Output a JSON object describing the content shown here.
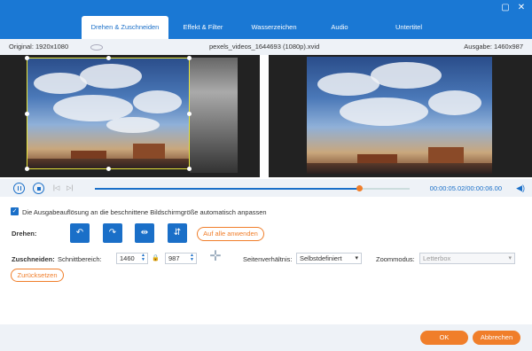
{
  "tabs": [
    {
      "label": "Drehen & Zuschneiden"
    },
    {
      "label": "Effekt & Filter"
    },
    {
      "label": "Wasserzeichen"
    },
    {
      "label": "Audio"
    },
    {
      "label": "Untertitel"
    }
  ],
  "window": {
    "minimize_icon": "minimize-icon",
    "close_icon": "close-icon"
  },
  "info": {
    "original": "Original: 1920x1080",
    "filename": "pexels_videos_1644693 (1080p).xvid",
    "output": "Ausgabe: 1460x987"
  },
  "player": {
    "time": "00:00:05.02/00:00:06.00",
    "progress": 0.84
  },
  "auto_resize": {
    "label": "Die Ausgabeauflösung an die beschnittene Bildschirmgröße automatisch anpassen",
    "checked": true
  },
  "rotate": {
    "label": "Drehen:",
    "apply_all": "Auf alle anwenden"
  },
  "crop": {
    "label": "Zuschneiden:",
    "area_label": "Schnittbereich:",
    "width": "1460",
    "height": "987",
    "aspect_label": "Seitenverhältnis:",
    "aspect_value": "Selbstdefiniert",
    "zoom_label": "Zoommodus:",
    "zoom_value": "Letterbox",
    "reset": "Zurücksetzen"
  },
  "footer": {
    "ok": "OK",
    "cancel": "Abbrechen"
  },
  "colors": {
    "accent": "#1a78d4",
    "orange": "#f07e2a"
  }
}
